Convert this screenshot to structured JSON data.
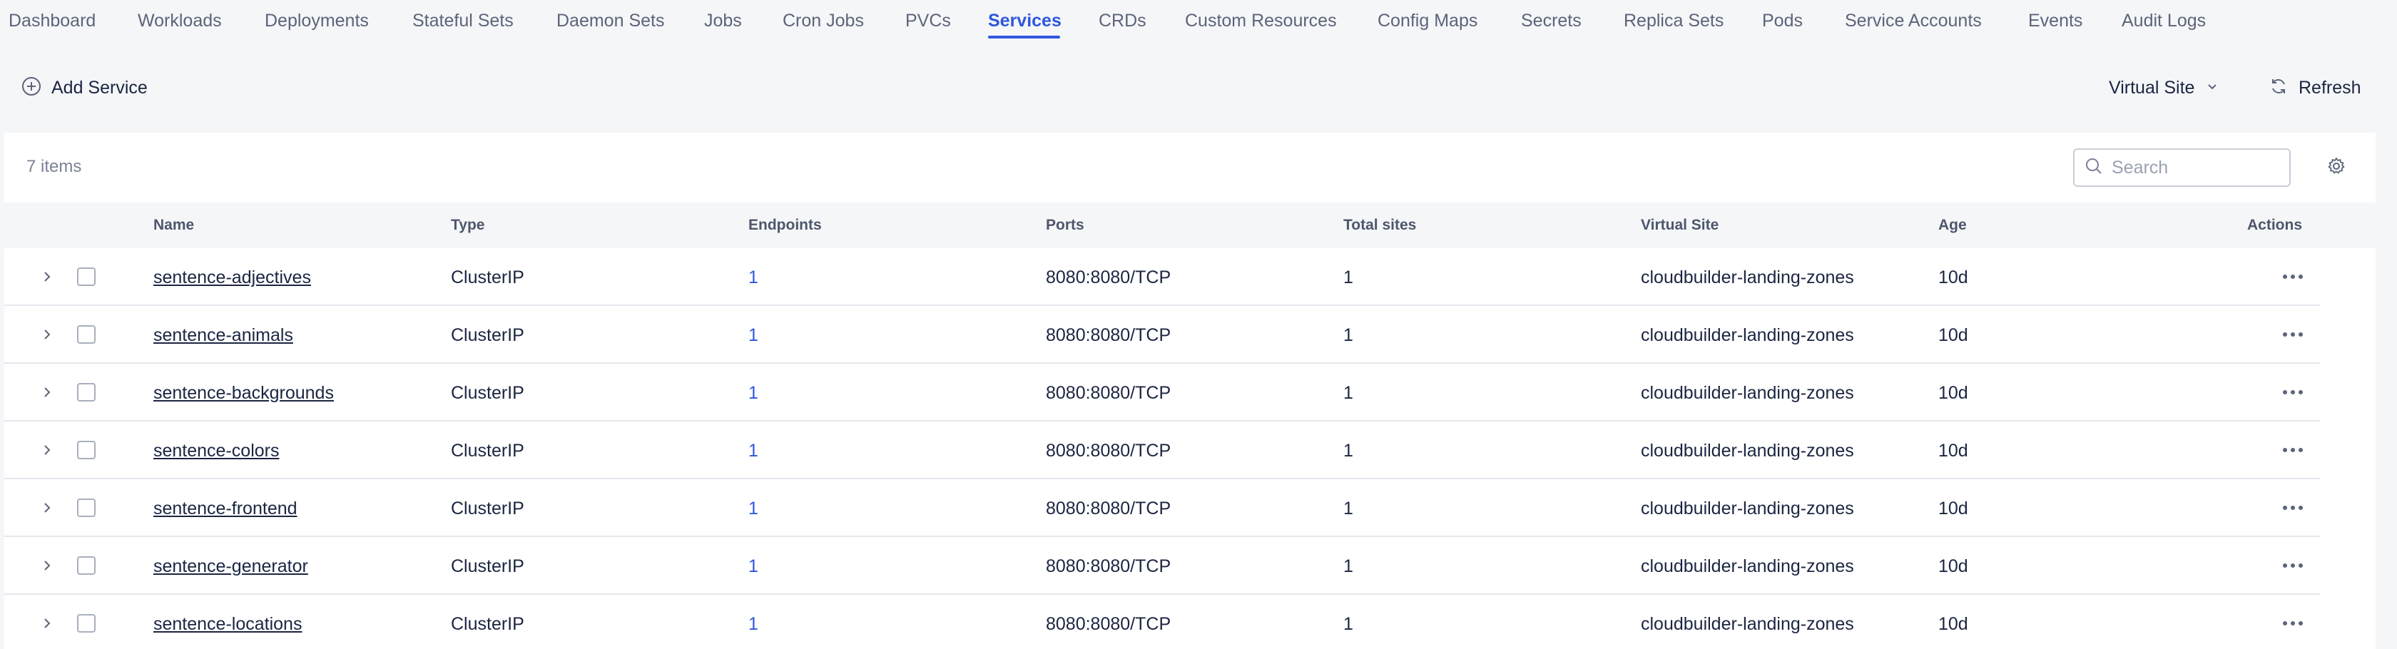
{
  "nav": {
    "tabs": [
      {
        "label": "Dashboard"
      },
      {
        "label": "Workloads"
      },
      {
        "label": "Deployments"
      },
      {
        "label": "Stateful Sets"
      },
      {
        "label": "Daemon Sets"
      },
      {
        "label": "Jobs"
      },
      {
        "label": "Cron Jobs"
      },
      {
        "label": "PVCs"
      },
      {
        "label": "Services",
        "active": true
      },
      {
        "label": "CRDs"
      },
      {
        "label": "Custom Resources"
      },
      {
        "label": "Config Maps"
      },
      {
        "label": "Secrets"
      },
      {
        "label": "Replica Sets"
      },
      {
        "label": "Pods"
      },
      {
        "label": "Service Accounts"
      },
      {
        "label": "Events"
      },
      {
        "label": "Audit Logs"
      }
    ]
  },
  "toolbar": {
    "add_label": "Add Service",
    "add_icon": "plus-circle-icon",
    "virtual_site_label": "Virtual Site",
    "virtual_site_icon": "chevron-down-icon",
    "refresh_label": "Refresh",
    "refresh_icon": "refresh-icon"
  },
  "table": {
    "item_count": "7 items",
    "search_placeholder": "Search",
    "columns": {
      "name": "Name",
      "type": "Type",
      "endpoints": "Endpoints",
      "ports": "Ports",
      "total_sites": "Total sites",
      "virtual_site": "Virtual Site",
      "age": "Age",
      "actions": "Actions"
    },
    "rows": [
      {
        "name": "sentence-adjectives",
        "type": "ClusterIP",
        "endpoints": "1",
        "ports": "8080:8080/TCP",
        "total_sites": "1",
        "virtual_site": "cloudbuilder-landing-zones",
        "age": "10d"
      },
      {
        "name": "sentence-animals",
        "type": "ClusterIP",
        "endpoints": "1",
        "ports": "8080:8080/TCP",
        "total_sites": "1",
        "virtual_site": "cloudbuilder-landing-zones",
        "age": "10d"
      },
      {
        "name": "sentence-backgrounds",
        "type": "ClusterIP",
        "endpoints": "1",
        "ports": "8080:8080/TCP",
        "total_sites": "1",
        "virtual_site": "cloudbuilder-landing-zones",
        "age": "10d"
      },
      {
        "name": "sentence-colors",
        "type": "ClusterIP",
        "endpoints": "1",
        "ports": "8080:8080/TCP",
        "total_sites": "1",
        "virtual_site": "cloudbuilder-landing-zones",
        "age": "10d"
      },
      {
        "name": "sentence-frontend",
        "type": "ClusterIP",
        "endpoints": "1",
        "ports": "8080:8080/TCP",
        "total_sites": "1",
        "virtual_site": "cloudbuilder-landing-zones",
        "age": "10d"
      },
      {
        "name": "sentence-generator",
        "type": "ClusterIP",
        "endpoints": "1",
        "ports": "8080:8080/TCP",
        "total_sites": "1",
        "virtual_site": "cloudbuilder-landing-zones",
        "age": "10d"
      },
      {
        "name": "sentence-locations",
        "type": "ClusterIP",
        "endpoints": "1",
        "ports": "8080:8080/TCP",
        "total_sites": "1",
        "virtual_site": "cloudbuilder-landing-zones",
        "age": "10d"
      }
    ]
  },
  "colors": {
    "accent": "#2f57de",
    "text": "#1b2541",
    "muted": "#5b6479",
    "background": "#f5f6f8"
  }
}
